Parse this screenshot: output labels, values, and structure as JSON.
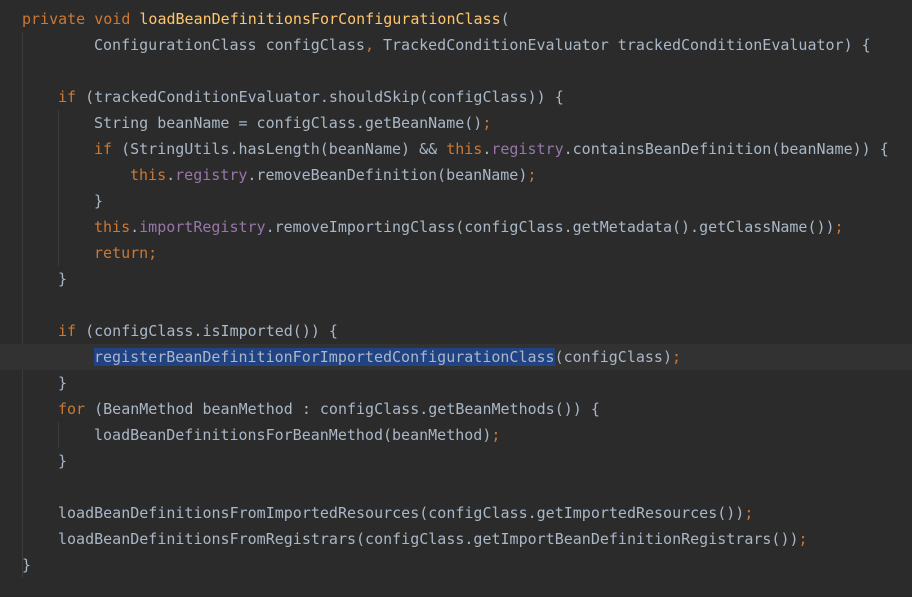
{
  "editor": {
    "colors": {
      "background": "#2b2b2b",
      "current_line": "#323232",
      "keyword": "#cc7832",
      "method_declaration": "#ffc66d",
      "field": "#9876aa",
      "text": "#a9b7c6",
      "selection": "#214283"
    },
    "lines": [
      {
        "indent": 0,
        "tokens": [
          {
            "text": "private void ",
            "kind": "kw"
          },
          {
            "text": "loadBeanDefinitionsForConfigurationClass",
            "kind": "fn"
          },
          {
            "text": "(",
            "kind": "plain"
          }
        ]
      },
      {
        "indent": 2,
        "tokens": [
          {
            "text": "ConfigurationClass configClass",
            "kind": "plain"
          },
          {
            "text": ", ",
            "kind": "kw"
          },
          {
            "text": "TrackedConditionEvaluator trackedConditionEvaluator) {",
            "kind": "plain"
          }
        ]
      },
      {
        "indent": 0,
        "tokens": []
      },
      {
        "indent": 1,
        "tokens": [
          {
            "text": "if ",
            "kind": "kw"
          },
          {
            "text": "(trackedConditionEvaluator.shouldSkip(configClass)) {",
            "kind": "plain"
          }
        ]
      },
      {
        "indent": 2,
        "tokens": [
          {
            "text": "String beanName = configClass.getBeanName()",
            "kind": "plain"
          },
          {
            "text": ";",
            "kind": "kw"
          }
        ]
      },
      {
        "indent": 2,
        "tokens": [
          {
            "text": "if ",
            "kind": "kw"
          },
          {
            "text": "(StringUtils.",
            "kind": "plain"
          },
          {
            "text": "hasLength",
            "kind": "italic"
          },
          {
            "text": "(beanName) && ",
            "kind": "plain"
          },
          {
            "text": "this",
            "kind": "kw"
          },
          {
            "text": ".",
            "kind": "plain"
          },
          {
            "text": "registry",
            "kind": "fld"
          },
          {
            "text": ".containsBeanDefinition(beanName)) {",
            "kind": "plain"
          }
        ]
      },
      {
        "indent": 3,
        "tokens": [
          {
            "text": "this",
            "kind": "kw"
          },
          {
            "text": ".",
            "kind": "plain"
          },
          {
            "text": "registry",
            "kind": "fld"
          },
          {
            "text": ".removeBeanDefinition(beanName)",
            "kind": "plain"
          },
          {
            "text": ";",
            "kind": "kw"
          }
        ]
      },
      {
        "indent": 2,
        "tokens": [
          {
            "text": "}",
            "kind": "plain"
          }
        ]
      },
      {
        "indent": 2,
        "tokens": [
          {
            "text": "this",
            "kind": "kw"
          },
          {
            "text": ".",
            "kind": "plain"
          },
          {
            "text": "importRegistry",
            "kind": "fld"
          },
          {
            "text": ".removeImportingClass(configClass.getMetadata().getClassName())",
            "kind": "plain"
          },
          {
            "text": ";",
            "kind": "kw"
          }
        ]
      },
      {
        "indent": 2,
        "tokens": [
          {
            "text": "return;",
            "kind": "kw"
          }
        ]
      },
      {
        "indent": 1,
        "tokens": [
          {
            "text": "}",
            "kind": "plain"
          }
        ]
      },
      {
        "indent": 0,
        "tokens": []
      },
      {
        "indent": 1,
        "tokens": [
          {
            "text": "if ",
            "kind": "kw"
          },
          {
            "text": "(configClass.isImported()) {",
            "kind": "plain"
          }
        ]
      },
      {
        "indent": 2,
        "current": true,
        "tokens": [
          {
            "text": "registerBeanDefinitionForImportedConfigurationClass",
            "kind": "sel"
          },
          {
            "text": "(configClass)",
            "kind": "plain"
          },
          {
            "text": ";",
            "kind": "kw"
          }
        ]
      },
      {
        "indent": 1,
        "tokens": [
          {
            "text": "}",
            "kind": "plain"
          }
        ]
      },
      {
        "indent": 1,
        "tokens": [
          {
            "text": "for ",
            "kind": "kw"
          },
          {
            "text": "(BeanMethod beanMethod : configClass.getBeanMethods()) {",
            "kind": "plain"
          }
        ]
      },
      {
        "indent": 2,
        "tokens": [
          {
            "text": "loadBeanDefinitionsForBeanMethod(beanMethod)",
            "kind": "plain"
          },
          {
            "text": ";",
            "kind": "kw"
          }
        ]
      },
      {
        "indent": 1,
        "tokens": [
          {
            "text": "}",
            "kind": "plain"
          }
        ]
      },
      {
        "indent": 0,
        "tokens": []
      },
      {
        "indent": 1,
        "tokens": [
          {
            "text": "loadBeanDefinitionsFromImportedResources(configClass.getImportedResources())",
            "kind": "plain"
          },
          {
            "text": ";",
            "kind": "kw"
          }
        ]
      },
      {
        "indent": 1,
        "tokens": [
          {
            "text": "loadBeanDefinitionsFromRegistrars(configClass.getImportBeanDefinitionRegistrars())",
            "kind": "plain"
          },
          {
            "text": ";",
            "kind": "kw"
          }
        ]
      },
      {
        "indent": 0,
        "tokens": [
          {
            "text": "}",
            "kind": "plain"
          }
        ]
      }
    ]
  }
}
